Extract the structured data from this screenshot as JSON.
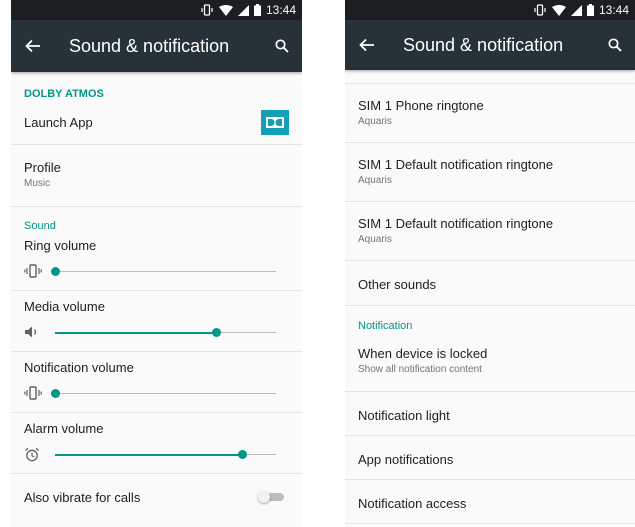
{
  "status": {
    "time": "13:44"
  },
  "left": {
    "title": "Sound & notification",
    "dolby": {
      "header": "DOLBY ATMOS",
      "launch_label": "Launch App",
      "profile_label": "Profile",
      "profile_value": "Music"
    },
    "sound_header": "Sound",
    "volumes": [
      {
        "label": "Ring volume",
        "icon": "vibrate-icon",
        "level": 0.0
      },
      {
        "label": "Media volume",
        "icon": "speaker-icon",
        "level": 0.73
      },
      {
        "label": "Notification volume",
        "icon": "vibrate-icon",
        "level": 0.0
      },
      {
        "label": "Alarm volume",
        "icon": "alarm-clock-icon",
        "level": 0.85
      }
    ],
    "vibrate_label": "Also vibrate for calls",
    "vibrate_on": false
  },
  "right": {
    "title": "Sound & notification",
    "ringtones": [
      {
        "title": "SIM 1 Phone ringtone",
        "value": "Aquaris"
      },
      {
        "title": "SIM 1 Default notification ringtone",
        "value": "Aquaris"
      },
      {
        "title": "SIM 1 Default notification ringtone",
        "value": "Aquaris"
      }
    ],
    "other_sounds": "Other sounds",
    "notification_header": "Notification",
    "locked_title": "When device is locked",
    "locked_value": "Show all notification content",
    "notification_light": "Notification light",
    "app_notifications": "App notifications",
    "notification_access": "Notification access"
  },
  "colors": {
    "accent": "#009688",
    "toolbar": "#263238",
    "statusbar": "#1b1f22",
    "dolby": "#129fb7"
  }
}
